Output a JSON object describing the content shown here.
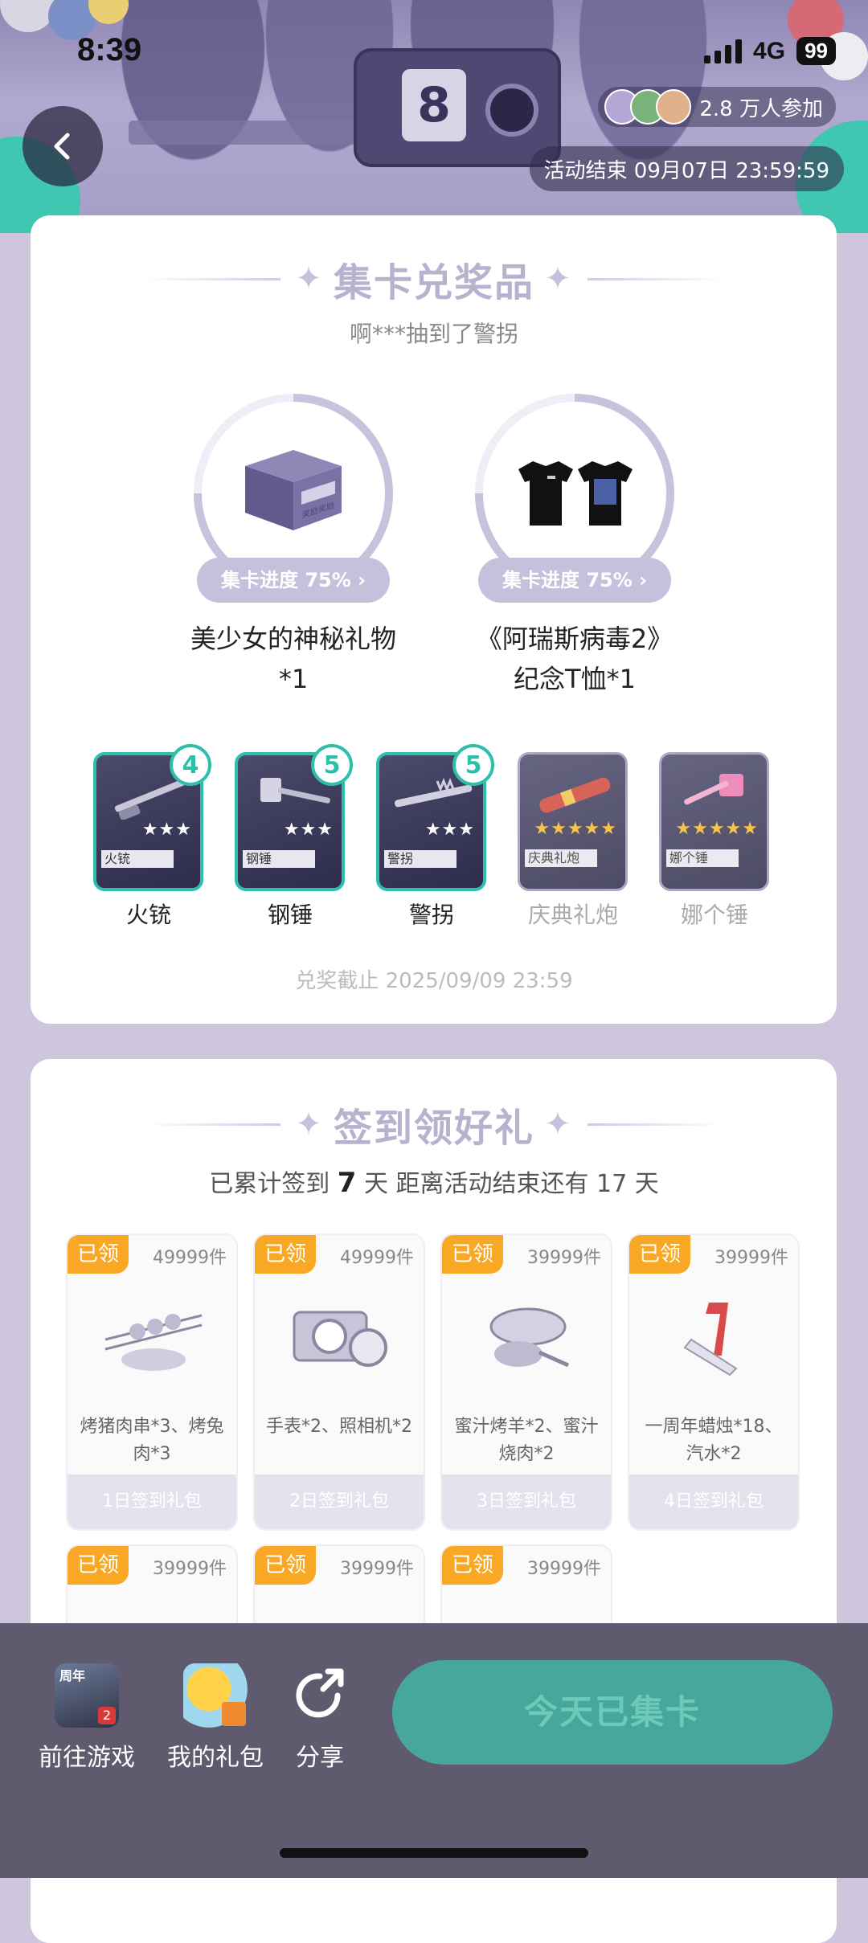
{
  "status_bar": {
    "time": "8:39",
    "network": "4G",
    "battery": "99"
  },
  "header": {
    "participants": "2.8 万人参加",
    "end_time": "活动结束 09月07日 23:59:59"
  },
  "prizes_section": {
    "title": "集卡兑奖品",
    "subtitle": "啊***抽到了警拐",
    "prizes": [
      {
        "name_line1": "美少女的神秘礼物",
        "name_line2": "*1",
        "progress_label": "集卡进度 75%",
        "progress": 0.75,
        "image_text": "奖励奖励"
      },
      {
        "name_line1": "《阿瑞斯病毒2》",
        "name_line2": "纪念T恤*1",
        "progress_label": "集卡进度 75%",
        "progress": 0.75
      }
    ],
    "cards": [
      {
        "label": "火铳",
        "tag": "火铳",
        "count": "4",
        "stars": "★★★",
        "owned": true
      },
      {
        "label": "钢锤",
        "tag": "钢锤",
        "count": "5",
        "stars": "★★★",
        "owned": true
      },
      {
        "label": "警拐",
        "tag": "警拐",
        "count": "5",
        "stars": "★★★",
        "owned": true
      },
      {
        "label": "庆典礼炮",
        "tag": "庆典礼炮",
        "stars": "★★★★★",
        "owned": false
      },
      {
        "label": "娜个锤",
        "tag": "娜个锤",
        "stars": "★★★★★",
        "owned": false
      }
    ],
    "deadline": "兑奖截止 2025/09/09 23:59"
  },
  "signin_section": {
    "title": "签到领好礼",
    "info_prefix": "已累计签到",
    "days": "7",
    "info_suffix": "天  距离活动结束还有 17 天",
    "gifts": [
      {
        "status": "已领",
        "stock": "49999件",
        "desc": "烤猪肉串*3、烤兔肉*3",
        "day": "1日签到礼包"
      },
      {
        "status": "已领",
        "stock": "49999件",
        "desc": "手表*2、照相机*2",
        "day": "2日签到礼包"
      },
      {
        "status": "已领",
        "stock": "39999件",
        "desc": "蜜汁烤羊*2、蜜汁烧肉*2",
        "day": "3日签到礼包"
      },
      {
        "status": "已领",
        "stock": "39999件",
        "desc": "一周年蜡烛*18、汽水*2",
        "day": "4日签到礼包"
      },
      {
        "status": "已领",
        "stock": "39999件"
      },
      {
        "status": "已领",
        "stock": "39999件"
      },
      {
        "status": "已领",
        "stock": "39999件"
      }
    ]
  },
  "bottom_bar": {
    "go_game": "前往游戏",
    "my_gifts": "我的礼包",
    "share": "分享",
    "game_icon_text": "周年",
    "game_icon_badge": "2",
    "collect_button": "今天已集卡"
  },
  "icons": [
    "back-arrow-icon",
    "chevron-right-icon",
    "share-icon",
    "four-point-star-icon"
  ],
  "colors": {
    "accent_teal": "#2ebfa8",
    "claimed_orange": "#f9a825",
    "lavender": "#c7c0dc"
  }
}
